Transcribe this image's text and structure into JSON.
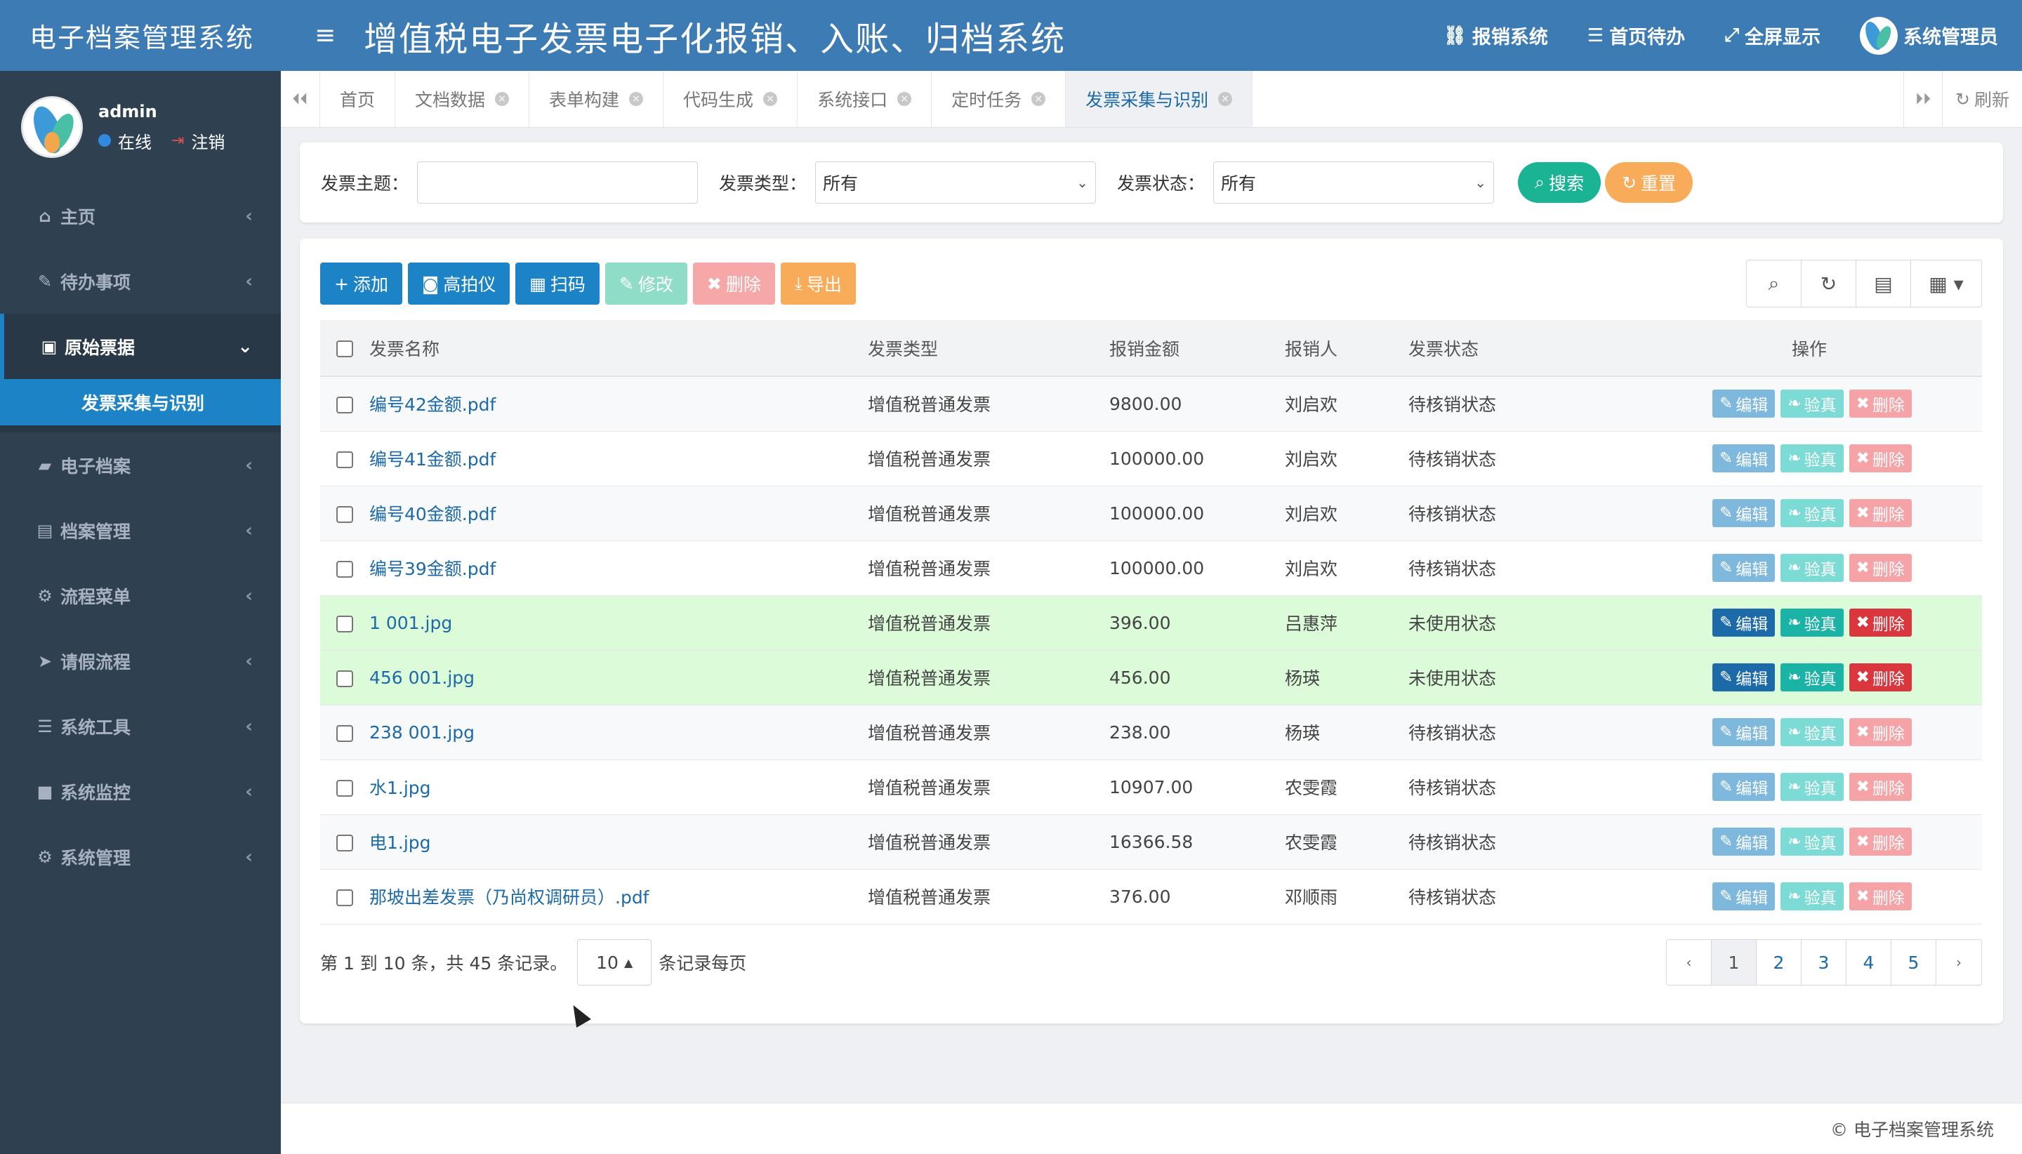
{
  "sidebar": {
    "brand": "电子档案管理系统",
    "user": {
      "name": "admin",
      "status": "在线",
      "logout": "注销"
    },
    "items": [
      {
        "label": "主页",
        "icon": "home-icon",
        "glyph": "⌂"
      },
      {
        "label": "待办事项",
        "icon": "edit-icon",
        "glyph": "✎"
      },
      {
        "label": "原始票据",
        "icon": "money-icon",
        "glyph": "▣",
        "active": true,
        "sub": [
          {
            "label": "发票采集与识别"
          }
        ]
      },
      {
        "label": "电子档案",
        "icon": "folder-icon",
        "glyph": "▰"
      },
      {
        "label": "档案管理",
        "icon": "archive-icon",
        "glyph": "▤"
      },
      {
        "label": "流程菜单",
        "icon": "cogs-icon",
        "glyph": "⚙"
      },
      {
        "label": "请假流程",
        "icon": "send-icon",
        "glyph": "➤"
      },
      {
        "label": "系统工具",
        "icon": "bars-icon",
        "glyph": "☰"
      },
      {
        "label": "系统监控",
        "icon": "video-icon",
        "glyph": "■"
      },
      {
        "label": "系统管理",
        "icon": "gear-icon",
        "glyph": "⚙"
      }
    ]
  },
  "header": {
    "title": "增值税电子发票电子化报销、入账、归档系统",
    "links": [
      {
        "label": "报销系统",
        "icon": "link-icon",
        "glyph": "⛓"
      },
      {
        "label": "首页待办",
        "icon": "list-icon",
        "glyph": "☰"
      },
      {
        "label": "全屏显示",
        "icon": "fullscreen-icon",
        "glyph": "⤢"
      }
    ],
    "user": "系统管理员"
  },
  "tabs": [
    {
      "label": "首页",
      "closable": false
    },
    {
      "label": "文档数据",
      "closable": true
    },
    {
      "label": "表单构建",
      "closable": true
    },
    {
      "label": "代码生成",
      "closable": true
    },
    {
      "label": "系统接口",
      "closable": true
    },
    {
      "label": "定时任务",
      "closable": true
    },
    {
      "label": "发票采集与识别",
      "closable": true,
      "active": true
    }
  ],
  "refresh_label": "刷新",
  "search": {
    "subject_label": "发票主题：",
    "subject_value": "",
    "type_label": "发票类型：",
    "type_value": "所有",
    "status_label": "发票状态：",
    "status_value": "所有",
    "search_btn": "搜索",
    "reset_btn": "重置"
  },
  "toolbar": {
    "add": "添加",
    "camera": "高拍仪",
    "scan": "扫码",
    "modify": "修改",
    "delete": "删除",
    "export": "导出"
  },
  "table": {
    "headers": [
      "发票名称",
      "发票类型",
      "报销金额",
      "报销人",
      "发票状态",
      "操作"
    ],
    "ops": {
      "edit": "编辑",
      "verify": "验真",
      "delete": "删除"
    },
    "rows": [
      {
        "name": "编号42金额.pdf",
        "type": "增值税普通发票",
        "amount": "9800.00",
        "person": "刘启欢",
        "status": "待核销状态",
        "highlight": false
      },
      {
        "name": "编号41金额.pdf",
        "type": "增值税普通发票",
        "amount": "100000.00",
        "person": "刘启欢",
        "status": "待核销状态",
        "highlight": false
      },
      {
        "name": "编号40金额.pdf",
        "type": "增值税普通发票",
        "amount": "100000.00",
        "person": "刘启欢",
        "status": "待核销状态",
        "highlight": false
      },
      {
        "name": "编号39金额.pdf",
        "type": "增值税普通发票",
        "amount": "100000.00",
        "person": "刘启欢",
        "status": "待核销状态",
        "highlight": false
      },
      {
        "name": "1 001.jpg",
        "type": "增值税普通发票",
        "amount": "396.00",
        "person": "吕惠萍",
        "status": "未使用状态",
        "highlight": true
      },
      {
        "name": "456 001.jpg",
        "type": "增值税普通发票",
        "amount": "456.00",
        "person": "杨瑛",
        "status": "未使用状态",
        "highlight": true
      },
      {
        "name": "238 001.jpg",
        "type": "增值税普通发票",
        "amount": "238.00",
        "person": "杨瑛",
        "status": "待核销状态",
        "highlight": false
      },
      {
        "name": "水1.jpg",
        "type": "增值税普通发票",
        "amount": "10907.00",
        "person": "农雯霞",
        "status": "待核销状态",
        "highlight": false
      },
      {
        "name": "电1.jpg",
        "type": "增值税普通发票",
        "amount": "16366.58",
        "person": "农雯霞",
        "status": "待核销状态",
        "highlight": false
      },
      {
        "name": "那坡出差发票（乃尚权调研员）.pdf",
        "type": "增值税普通发票",
        "amount": "376.00",
        "person": "邓顺雨",
        "status": "待核销状态",
        "highlight": false
      }
    ]
  },
  "pagination": {
    "summary": "第 1 到 10 条，共 45 条记录。",
    "page_size": "10",
    "per_page_label": "条记录每页",
    "prev": "‹",
    "next": "›",
    "pages": [
      "1",
      "2",
      "3",
      "4",
      "5"
    ],
    "current": "1"
  },
  "footer": "© 电子档案管理系统",
  "colors": {
    "header": "#3d7bb5",
    "sidebar": "#2f4050",
    "accent": "#1c84c6",
    "highlight_row": "#dcfcd9"
  }
}
